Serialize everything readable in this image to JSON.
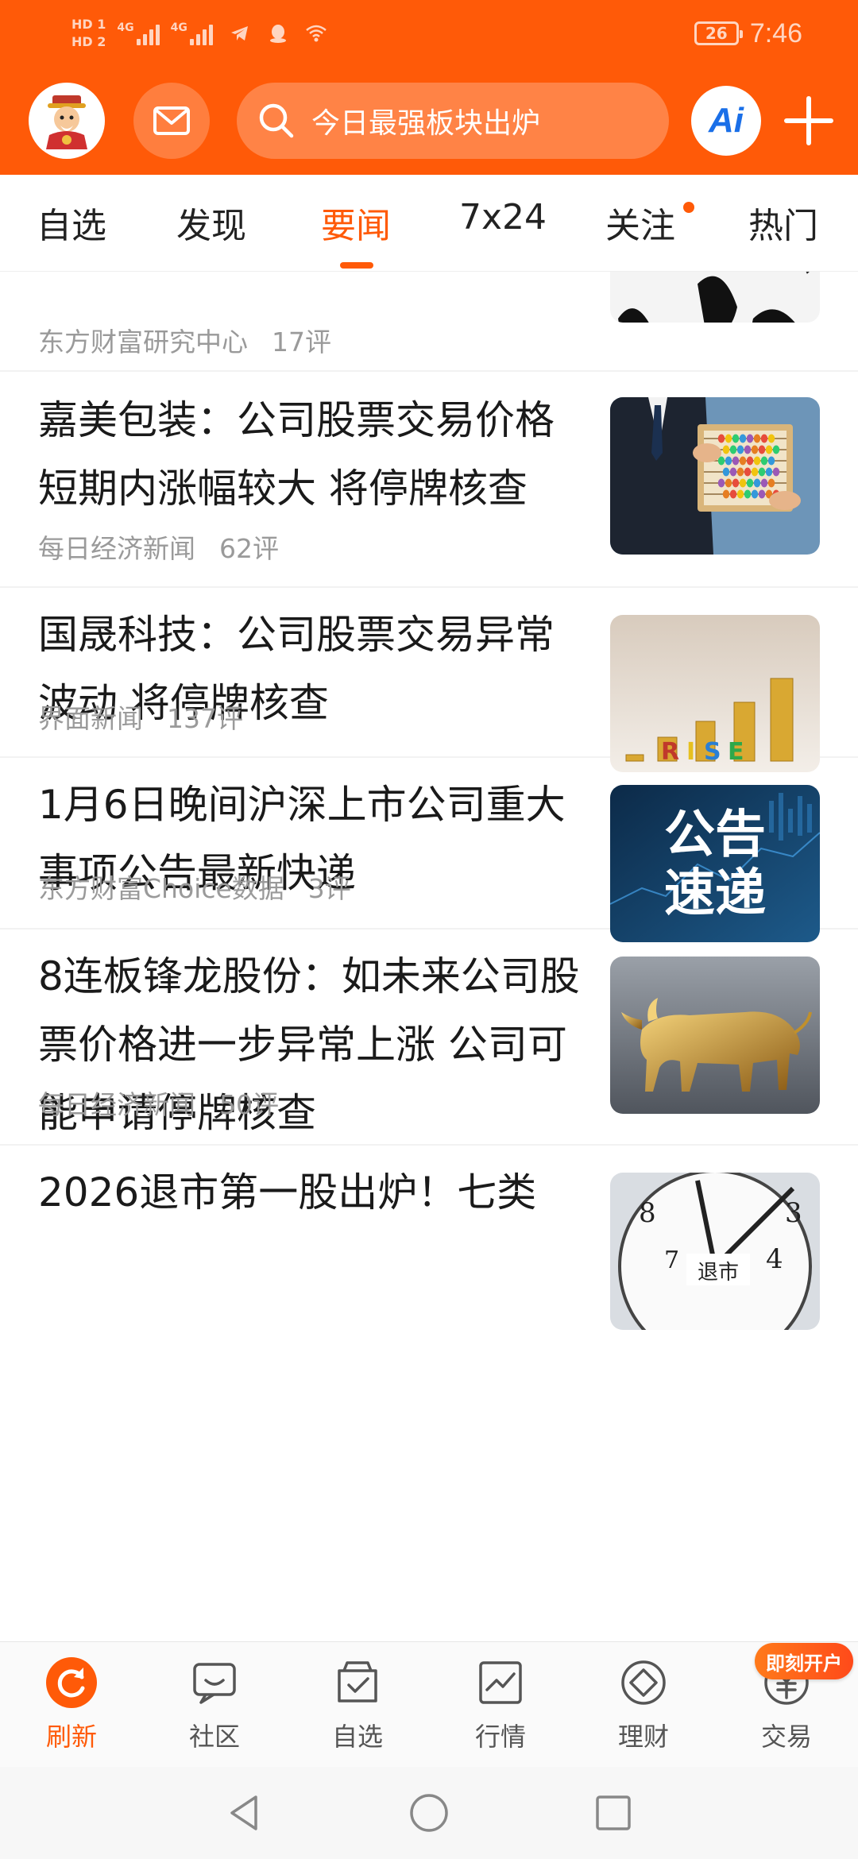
{
  "status_bar": {
    "network_tags": [
      "HD 1",
      "HD 2"
    ],
    "signal_labels": [
      "4G",
      "4G"
    ],
    "battery": "26",
    "time": "7:46"
  },
  "header": {
    "search_placeholder": "今日最强板块出炉",
    "ai_label": "Ai",
    "accent_color": "#ff5a08"
  },
  "tabs": [
    {
      "label": "自选",
      "active": false
    },
    {
      "label": "发现",
      "active": false
    },
    {
      "label": "要闻",
      "active": true
    },
    {
      "label": "7x24",
      "active": false
    },
    {
      "label": "关注",
      "active": false,
      "dot": true
    },
    {
      "label": "热门",
      "active": false
    }
  ],
  "feed": [
    {
      "title": "",
      "source": "东方财富研究中心",
      "comments": "17评",
      "thumb": "black-white-pattern"
    },
    {
      "title": "嘉美包装：公司股票交易价格短期内涨幅较大 将停牌核查",
      "source": "每日经济新闻",
      "comments": "62评",
      "thumb": "abacus"
    },
    {
      "title": "国晟科技：公司股票交易异常波动 将停牌核查",
      "source": "界面新闻",
      "comments": "137评",
      "thumb": "coins-rise"
    },
    {
      "title": "1月6日晚间沪深上市公司重大事项公告最新快递",
      "source": "东方财富Choice数据",
      "comments": "3评",
      "thumb": "announcement"
    },
    {
      "title": "8连板锋龙股份：如未来公司股票价格进一步异常上涨 公司可能申请停牌核查",
      "source": "每日经济新闻",
      "comments": "50评",
      "thumb": "golden-bull"
    },
    {
      "title": "2026退市第一股出炉！七类",
      "source": "",
      "comments": "",
      "thumb": "clock"
    }
  ],
  "thumb_texts": {
    "rise": "RISE",
    "announce_line1": "公告",
    "announce_line2": "速递",
    "clock_caption": "退市"
  },
  "bottom_nav": [
    {
      "label": "刷新",
      "icon": "refresh-icon",
      "active": true
    },
    {
      "label": "社区",
      "icon": "community-icon",
      "active": false
    },
    {
      "label": "自选",
      "icon": "watchlist-icon",
      "active": false
    },
    {
      "label": "行情",
      "icon": "market-icon",
      "active": false
    },
    {
      "label": "理财",
      "icon": "wealth-icon",
      "active": false
    },
    {
      "label": "交易",
      "icon": "trade-icon",
      "active": false
    }
  ],
  "promo_badge": "即刻开户"
}
